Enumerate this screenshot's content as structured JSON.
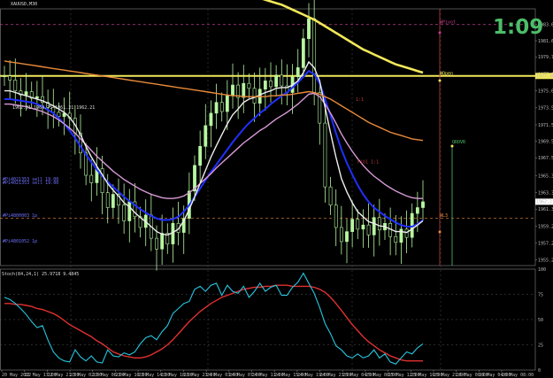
{
  "header": {
    "symbol_caption": "XAUUSD,M30",
    "ohlc_caption": "1962.01 1964.75 1961.21 1962.21"
  },
  "timer": "1:09",
  "stoch_caption": "Stoch(84,24,1) 25.9718 9.4845",
  "colors": {
    "background": "#000000",
    "candle": "#b7f7a0",
    "ma_fast": "#2030ff",
    "ma_pink": "#d89ad8",
    "ma_white": "#eeeeee",
    "ma_orange": "#e98a3a",
    "ma_yellow": "#f2e85a",
    "stoch_main": "#27c6e0",
    "stoch_signal": "#e23030"
  },
  "chart_data": {
    "type": "line",
    "price_axis": {
      "ticks": [
        "1983.60",
        "1981.65",
        "1979.70",
        "1977.60",
        "1975.60",
        "1973.55",
        "1971.50",
        "1969.50",
        "1967.50",
        "1965.35",
        "1963.30",
        "1961.30",
        "1959.25",
        "1957.20",
        "1955.20"
      ],
      "ylim": [
        1954.5,
        1985.5
      ],
      "current_price": "1962.21",
      "current_marker": "1977.40"
    },
    "time_axis": {
      "ticks": [
        "20 May 2022",
        "22 May 17:00",
        "22 May 21:00",
        "23 May 02:00",
        "23 May 06:00",
        "23 May 10:00",
        "23 May 14:00",
        "23 May 18:00",
        "23 May 23:00",
        "24 May 03:00",
        "24 May 07:00",
        "24 May 11:00",
        "24 May 15:00",
        "24 May 19:00",
        "24 May 23:00",
        "25 May 04:00",
        "25 May 08:00",
        "25 May 12:00",
        "25 May 16:00",
        "25 May 21:00",
        "26 May 00:00",
        "26 May 04:00",
        "26 May 08:00"
      ]
    },
    "close_series": [
      1977.4,
      1976.9,
      1975.6,
      1975.1,
      1975.5,
      1974.7,
      1974.9,
      1974.2,
      1973.6,
      1973.0,
      1972.5,
      1972.9,
      1972.3,
      1970.5,
      1968.1,
      1965.4,
      1964.5,
      1966.2,
      1963.3,
      1961.5,
      1963.1,
      1961.8,
      1959.9,
      1962.2,
      1960.4,
      1959.1,
      1960.6,
      1957.8,
      1956.5,
      1958.4,
      1957.1,
      1959.6,
      1958.5,
      1960.2,
      1963.5,
      1966.6,
      1968.9,
      1971.4,
      1972.9,
      1974.2,
      1973.1,
      1975.0,
      1976.3,
      1974.8,
      1976.5,
      1975.9,
      1974.1,
      1975.8,
      1976.8,
      1976.1,
      1977.5,
      1976.2,
      1975.4,
      1977.3,
      1978.4,
      1981.9,
      1984.3,
      1975.4,
      1971.7,
      1964.0,
      1961.8,
      1959.1,
      1957.4,
      1958.6,
      1960.1,
      1958.9,
      1959.4,
      1958.2,
      1960.3,
      1958.8,
      1959.6,
      1958.0,
      1957.3,
      1958.9,
      1957.9,
      1960.8,
      1961.5,
      1962.2
    ],
    "series": [
      {
        "name": "",
        "color_key": "ma_fast",
        "values": [
          1974.6,
          1974.6,
          1974.5,
          1974.4,
          1974.3,
          1974.2,
          1974.0,
          1973.7,
          1973.3,
          1972.9,
          1972.3,
          1971.6,
          1970.8,
          1969.9,
          1968.9,
          1967.9,
          1967.0,
          1966.1,
          1965.3,
          1964.6,
          1964.0,
          1963.4,
          1962.8,
          1962.3,
          1961.8,
          1961.3,
          1960.9,
          1960.5,
          1960.2,
          1960.0,
          1960.0,
          1960.1,
          1960.4,
          1961.0,
          1961.8,
          1962.8,
          1963.8,
          1964.8,
          1965.8,
          1966.7,
          1967.6,
          1968.5,
          1969.4,
          1970.2,
          1971.0,
          1971.7,
          1972.3,
          1972.9,
          1973.4,
          1974.0,
          1974.5,
          1975.0,
          1975.4,
          1976.0,
          1976.6,
          1977.3,
          1978.0,
          1977.6,
          1976.5,
          1974.6,
          1972.6,
          1970.5,
          1968.5,
          1966.9,
          1965.5,
          1964.2,
          1963.1,
          1962.2,
          1961.5,
          1961.0,
          1960.5,
          1960.1,
          1959.7,
          1959.4,
          1959.2,
          1959.2,
          1959.5,
          1960.0
        ]
      },
      {
        "name": "",
        "color_key": "ma_pink",
        "values": [
          1974.0,
          1974.0,
          1973.9,
          1973.8,
          1973.7,
          1973.5,
          1973.3,
          1973.1,
          1972.8,
          1972.5,
          1972.1,
          1971.6,
          1971.1,
          1970.5,
          1969.8,
          1969.1,
          1968.4,
          1967.7,
          1967.1,
          1966.5,
          1965.9,
          1965.4,
          1964.9,
          1964.5,
          1964.1,
          1963.7,
          1963.4,
          1963.1,
          1962.9,
          1962.7,
          1962.6,
          1962.6,
          1962.7,
          1962.9,
          1963.3,
          1963.8,
          1964.4,
          1965.0,
          1965.6,
          1966.3,
          1966.9,
          1967.5,
          1968.1,
          1968.7,
          1969.3,
          1969.8,
          1970.3,
          1970.8,
          1971.2,
          1971.7,
          1972.2,
          1972.6,
          1973.0,
          1973.5,
          1974.0,
          1974.6,
          1975.2,
          1975.3,
          1974.9,
          1974.0,
          1972.9,
          1971.7,
          1970.4,
          1969.3,
          1968.3,
          1967.4,
          1966.6,
          1965.9,
          1965.3,
          1964.8,
          1964.3,
          1963.9,
          1963.5,
          1963.2,
          1962.9,
          1962.7,
          1962.6,
          1962.6
        ]
      },
      {
        "name": "",
        "color_key": "ma_white",
        "values": [
          1975.6,
          1975.6,
          1975.4,
          1975.2,
          1975.0,
          1974.8,
          1974.6,
          1974.4,
          1974.1,
          1973.8,
          1973.4,
          1973.0,
          1972.4,
          1971.5,
          1970.3,
          1968.9,
          1967.6,
          1966.5,
          1965.5,
          1964.4,
          1963.6,
          1962.9,
          1962.1,
          1961.6,
          1960.9,
          1960.3,
          1959.8,
          1959.2,
          1958.6,
          1958.3,
          1958.2,
          1958.5,
          1958.9,
          1959.9,
          1961.3,
          1962.8,
          1964.4,
          1966.0,
          1967.6,
          1969.0,
          1970.3,
          1971.6,
          1972.7,
          1973.4,
          1974.2,
          1974.6,
          1974.8,
          1975.1,
          1975.4,
          1975.6,
          1975.9,
          1976.0,
          1976.0,
          1976.3,
          1976.8,
          1977.8,
          1979.1,
          1978.4,
          1976.8,
          1973.6,
          1970.5,
          1967.6,
          1965.0,
          1963.4,
          1962.1,
          1961.0,
          1960.4,
          1959.8,
          1959.6,
          1959.3,
          1959.2,
          1958.9,
          1958.6,
          1958.6,
          1958.5,
          1958.9,
          1959.4,
          1959.9
        ]
      },
      {
        "name": "",
        "color_key": "ma_orange",
        "values": [
          1979.2,
          1979.1,
          1979.0,
          1978.9,
          1978.8,
          1978.7,
          1978.6,
          1978.5,
          1978.4,
          1978.3,
          1978.2,
          1978.1,
          1978.0,
          1977.9,
          1977.8,
          1977.7,
          1977.6,
          1977.5,
          1977.4,
          1977.3,
          1977.2,
          1977.1,
          1977.0,
          1976.9,
          1976.8,
          1976.7,
          1976.6,
          1976.5,
          1976.4,
          1976.3,
          1976.2,
          1976.1,
          1976.0,
          1975.9,
          1975.8,
          1975.7,
          1975.6,
          1975.5,
          1975.4,
          1975.3,
          1975.2,
          1975.1,
          1975.0,
          1975.0,
          1974.9,
          1974.9,
          1974.9,
          1974.9,
          1974.9,
          1975.0,
          1975.0,
          1975.1,
          1975.1,
          1975.2,
          1975.3,
          1975.4,
          1975.5,
          1975.4,
          1975.2,
          1974.9,
          1974.6,
          1974.2,
          1973.8,
          1973.4,
          1973.0,
          1972.6,
          1972.2,
          1971.8,
          1971.5,
          1971.2,
          1970.9,
          1970.6,
          1970.4,
          1970.2,
          1970.0,
          1969.8,
          1969.7,
          1969.6
        ]
      },
      {
        "name": "",
        "color_key": "ma_yellow",
        "values": [
          1991.5,
          1991.4,
          1991.3,
          1991.2,
          1991.1,
          1991.0,
          1990.9,
          1990.8,
          1990.7,
          1990.6,
          1990.5,
          1990.4,
          1990.3,
          1990.2,
          1990.1,
          1990.0,
          1989.9,
          1989.8,
          1989.7,
          1989.6,
          1989.5,
          1989.4,
          1989.3,
          1989.2,
          1989.1,
          1989.0,
          1988.9,
          1988.8,
          1988.7,
          1988.6,
          1988.5,
          1988.4,
          1988.3,
          1988.2,
          1988.1,
          1988.0,
          1987.9,
          1987.8,
          1987.7,
          1987.6,
          1987.5,
          1987.4,
          1987.3,
          1987.2,
          1987.1,
          1987.0,
          1986.9,
          1986.8,
          1986.6,
          1986.4,
          1986.2,
          1986.0,
          1985.7,
          1985.4,
          1985.1,
          1984.8,
          1984.5,
          1984.2,
          1983.8,
          1983.4,
          1983.0,
          1982.6,
          1982.2,
          1981.8,
          1981.4,
          1981.0,
          1980.6,
          1980.3,
          1980.0,
          1979.7,
          1979.4,
          1979.1,
          1978.8,
          1978.6,
          1978.4,
          1978.2,
          1978.0,
          1977.8
        ]
      }
    ],
    "levels": [
      {
        "label": "WPivot",
        "value": "1983.60",
        "color": "#c03c8c",
        "style": "dash"
      },
      {
        "label": "WOpen",
        "value": "1977.40",
        "color": "#f2e85a",
        "style": "solid"
      },
      {
        "label": "QROVR",
        "value": "1969.10",
        "color": "#4dbd6a",
        "style": "none"
      },
      {
        "label": "WL3",
        "value": "1960.20",
        "color": "#e98a3a",
        "style": "dash"
      },
      {
        "label": "#Pi4800003 1p",
        "value": "1960.20",
        "color": "#7070ff",
        "style": "none"
      },
      {
        "label": "#Pi4801052 1p",
        "value": "1957.10",
        "color": "#7070ff",
        "style": "none"
      },
      {
        "label": "#Pi4021353 sell 19.00",
        "value": "1964.60",
        "color": "#7070ff",
        "style": "none"
      },
      {
        "label": "#Pi4021353 sell 19.00",
        "value": "1964.20",
        "color": "#7070ff",
        "style": "none"
      },
      {
        "label": "1:1",
        "value": "1974.20",
        "color": "#c03c3c",
        "style": "none"
      },
      {
        "label": "Fib1 1:1",
        "value": "1966.70",
        "color": "#c03c3c",
        "style": "none"
      }
    ],
    "stochastic": {
      "ticks": [
        "100",
        "75",
        "50",
        "25",
        "0"
      ],
      "ylim": [
        0,
        100
      ],
      "main": [
        72,
        70,
        66,
        61,
        55,
        48,
        42,
        44,
        30,
        18,
        12,
        9,
        8,
        20,
        13,
        9,
        14,
        8,
        7,
        20,
        14,
        13,
        17,
        15,
        18,
        26,
        32,
        34,
        30,
        38,
        44,
        56,
        61,
        66,
        68,
        80,
        83,
        78,
        84,
        86,
        74,
        84,
        78,
        76,
        83,
        72,
        78,
        86,
        78,
        82,
        84,
        74,
        74,
        82,
        87,
        96,
        86,
        76,
        62,
        46,
        36,
        24,
        20,
        14,
        12,
        16,
        12,
        14,
        20,
        12,
        16,
        8,
        6,
        12,
        18,
        16,
        22,
        26
      ],
      "signal": [
        66,
        66,
        65,
        65,
        64,
        63,
        61,
        60,
        58,
        56,
        53,
        49,
        45,
        42,
        39,
        36,
        33,
        29,
        26,
        22,
        18,
        16,
        14,
        13,
        12,
        12,
        13,
        15,
        18,
        21,
        25,
        30,
        36,
        42,
        48,
        53,
        58,
        62,
        66,
        69,
        72,
        74,
        76,
        78,
        80,
        81,
        82,
        82,
        83,
        83,
        84,
        84,
        84,
        83,
        83,
        83,
        83,
        82,
        80,
        77,
        72,
        66,
        59,
        52,
        45,
        39,
        33,
        28,
        24,
        20,
        17,
        14,
        12,
        10,
        9,
        9,
        9,
        9
      ]
    }
  }
}
